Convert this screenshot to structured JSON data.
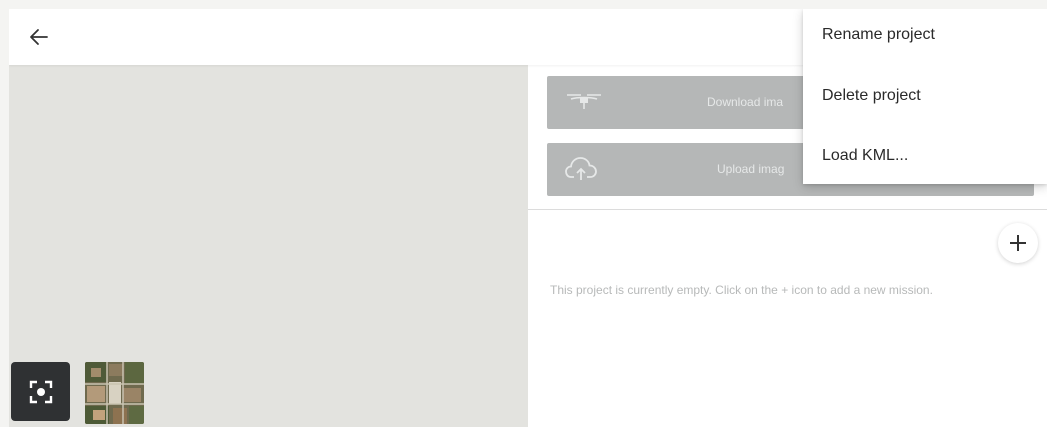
{
  "topbar": {
    "back_icon": "arrow-left-icon"
  },
  "panel": {
    "download_label": "Download ima",
    "download_icon": "drone-icon",
    "upload_label": "Upload imag",
    "upload_icon": "cloud-upload-icon",
    "add_icon": "plus-icon",
    "empty_message": "This project is currently empty. Click on the + icon to add a new mission."
  },
  "map": {
    "locate_icon": "focus-target-icon",
    "layer_thumbnail": "satellite-thumbnail"
  },
  "menu": {
    "items": [
      {
        "label": "Rename project"
      },
      {
        "label": "Delete project"
      },
      {
        "label": "Load KML..."
      }
    ]
  },
  "colors": {
    "action_button_bg": "#b5b7b7",
    "map_bg": "#e3e3df",
    "locate_button_bg": "#2f3133"
  }
}
